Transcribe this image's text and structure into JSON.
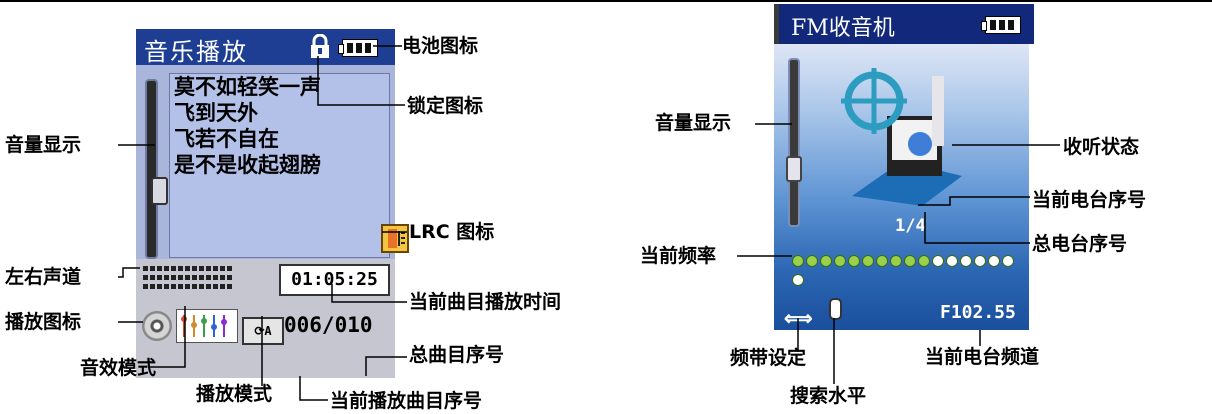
{
  "music_player": {
    "title": "音乐播放",
    "lyrics": [
      "莫不如轻笑一声",
      "飞到天外",
      "飞若不自在",
      "是不是收起翅膀"
    ],
    "time": "01:05:25",
    "track_number": "006/010",
    "mode_glyph": "⟳A"
  },
  "music_labels": {
    "battery": "电池图标",
    "lock": "锁定图标",
    "volume": "音量显示",
    "lrc": "LRC 图标",
    "channel": "左右声道",
    "current_time": "当前曲目播放时间",
    "play_icon": "播放图标",
    "eq_mode": "音效模式",
    "total_tracks": "总曲目序号",
    "play_mode": "播放模式",
    "current_track": "当前播放曲目序号"
  },
  "fm_radio": {
    "title": "FM收音机",
    "station_count": "1/4",
    "frequency": "F102.55",
    "band_glyph": "⟺",
    "freq_dots_filled": 10,
    "freq_dots_total": 17
  },
  "fm_labels": {
    "volume": "音量显示",
    "listening": "收听状态",
    "current_station": "当前电台序号",
    "current_freq": "当前频率",
    "total_stations": "总电台序号",
    "band": "频带设定",
    "channel": "当前电台频道",
    "search": "搜索水平"
  },
  "colors": {
    "title_bar": "#1d3e92",
    "lyrics_bg": "#b3c0e8",
    "fm_bg": "#1f5da8",
    "dot_filled": "#9ad14c",
    "dot_empty": "#ffffff"
  }
}
